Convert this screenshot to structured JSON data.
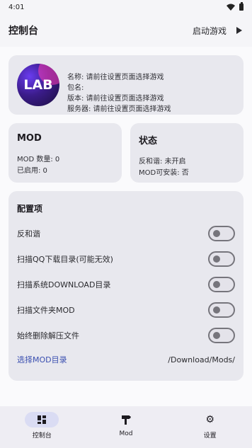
{
  "status_bar": {
    "time": "4:01"
  },
  "app_bar": {
    "title": "控制台",
    "launch_label": "启动游戏"
  },
  "logo": {
    "text": "LAB"
  },
  "info": {
    "name": "名称: 请前往设置页面选择游戏",
    "package": "包名:",
    "version": "版本: 请前往设置页面选择游戏",
    "server": "服务器: 请前往设置页面选择游戏"
  },
  "mod_card": {
    "title": "MOD",
    "count": "MOD 数量: 0",
    "enabled": "已启用: 0"
  },
  "state_card": {
    "title": "状态",
    "anti_harmony": "反和谐: 未开启",
    "installable": "MOD可安装: 否"
  },
  "config": {
    "title": "配置项",
    "items": [
      {
        "label": "反和谐",
        "enabled": false
      },
      {
        "label": "扫描QQ下载目录(可能无效)",
        "enabled": false
      },
      {
        "label": "扫描系统DOWNLOAD目录",
        "enabled": false
      },
      {
        "label": "扫描文件夹MOD",
        "enabled": false
      },
      {
        "label": "始终删除解压文件",
        "enabled": false
      }
    ],
    "dir_link": "选择MOD目录",
    "dir_path": "/Download/Mods/"
  },
  "nav": {
    "items": [
      {
        "label": "控制台",
        "icon": "dashboard-icon",
        "active": true
      },
      {
        "label": "Mod",
        "icon": "hammer-icon",
        "active": false
      },
      {
        "label": "设置",
        "icon": "gear-icon",
        "active": false
      }
    ]
  },
  "colors": {
    "accent": "#3a4fb0",
    "nav_active_bg": "#dadcf3",
    "card_bg": "#e8e8ee"
  }
}
